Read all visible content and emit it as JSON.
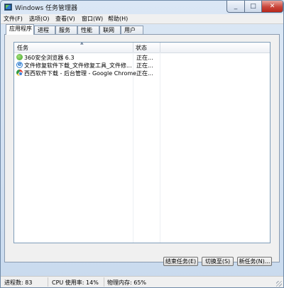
{
  "window": {
    "title": "Windows 任务管理器"
  },
  "menu": [
    "文件(F)",
    "选项(O)",
    "查看(V)",
    "窗口(W)",
    "帮助(H)"
  ],
  "tabs": [
    "应用程序",
    "进程",
    "服务",
    "性能",
    "联网",
    "用户"
  ],
  "active_tab": "应用程序",
  "list": {
    "columns": {
      "task": "任务",
      "status": "状态"
    },
    "rows": [
      {
        "icon": "360-browser-icon",
        "task": "360安全浏览器 6.3",
        "status": "正在..."
      },
      {
        "icon": "ie-icon",
        "task": "文件修复软件下载_文件修复工具_文件修...",
        "status": "正在..."
      },
      {
        "icon": "chrome-icon",
        "task": "西西软件下载 - 后台管理 - Google Chrome",
        "status": "正在..."
      }
    ]
  },
  "buttons": {
    "end_task": "结束任务(E)",
    "switch_to": "切换至(S)",
    "new_task": "新任务(N)..."
  },
  "status_bar": {
    "processes": "进程数: 83",
    "cpu": "CPU 使用率: 14%",
    "memory": "物理内存: 65%"
  },
  "colors": {
    "titlebar": "#dbe7f5",
    "close_button": "#c9453a",
    "accent": "#2b7fd6"
  }
}
